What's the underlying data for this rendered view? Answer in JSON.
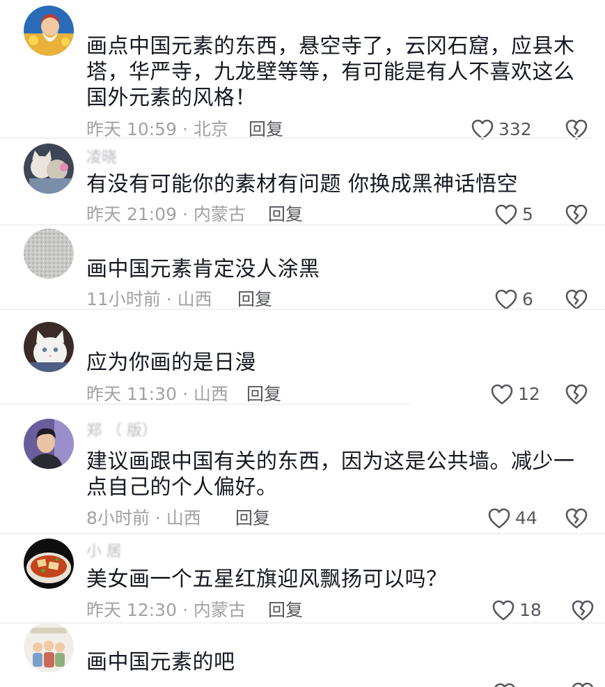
{
  "comments": [
    {
      "content_lines": [
        "画点中国元素的东西，悬空寺了，云冈石窟，应县木",
        "塔，华严寺，九龙壁等等，有可能是有人不喜欢这么",
        "国外元素的风格！"
      ],
      "time": "昨天 10:59 · 北京",
      "reply": "回复",
      "likes": "332",
      "avatar_icon": "cartoon-god-avatar"
    },
    {
      "username": "凌晓",
      "content_lines": [
        "有没有可能你的素材有问题 你换成黑神话悟空"
      ],
      "time": "昨天 21:09 · 内蒙古",
      "reply": "回复",
      "likes": "5",
      "avatar_icon": "cats-avatar"
    },
    {
      "content_lines": [
        "画中国元素肯定没人涂黑"
      ],
      "time": "11小时前 · 山西",
      "reply": "回复",
      "likes": "6",
      "avatar_icon": "gray-texture-avatar"
    },
    {
      "content_lines": [
        "应为你画的是日漫"
      ],
      "time": "昨天 11:30 · 山西",
      "reply": "回复",
      "likes": "12",
      "avatar_icon": "white-cat-avatar"
    },
    {
      "username": "郑 （ 版）",
      "content_lines": [
        "建议画跟中国有关的东西，因为这是公共墙。减少一",
        "点自己的个人偏好。"
      ],
      "time": "8小时前 · 山西",
      "reply": "回复",
      "likes": "44",
      "avatar_icon": "man-portrait-avatar"
    },
    {
      "username": "小 居",
      "content_lines": [
        "美女画一个五星红旗迎风飘扬可以吗？"
      ],
      "time": "昨天 12:30 · 内蒙古",
      "reply": "回复",
      "likes": "18",
      "avatar_icon": "food-dish-avatar"
    },
    {
      "content_lines": [
        "画中国元素的吧"
      ],
      "time": "",
      "reply": "",
      "likes": "",
      "avatar_icon": "family-cartoon-avatar"
    }
  ]
}
